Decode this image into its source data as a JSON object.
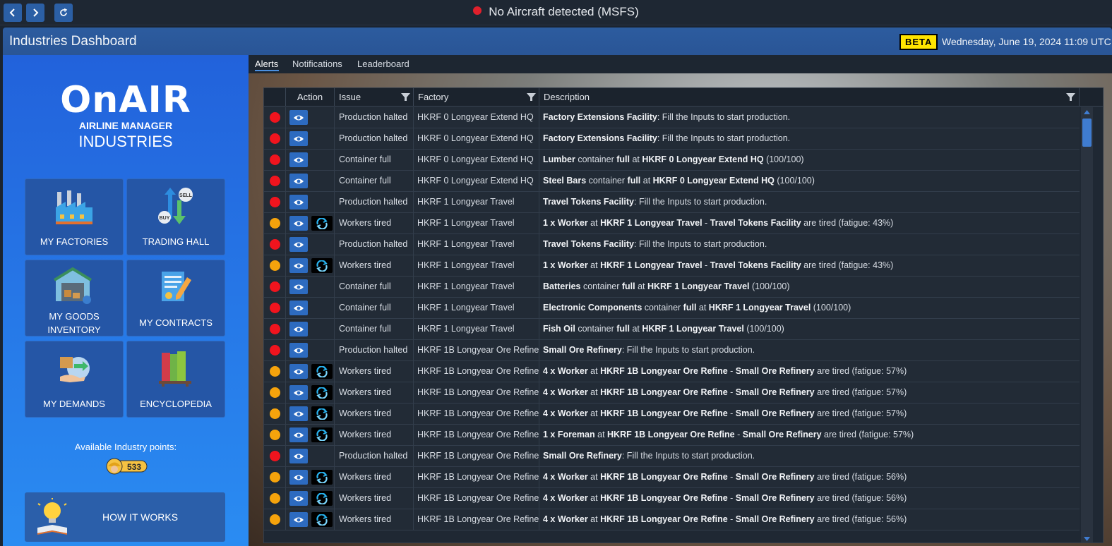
{
  "topbar": {
    "status_text": "No Aircraft detected (MSFS)",
    "status_color": "#e0202c"
  },
  "header": {
    "title": "Industries Dashboard",
    "beta_label": "BETA",
    "datetime": "Wednesday, June 19, 2024 11:09 UTC"
  },
  "logo": {
    "word": "OnAIR",
    "line1": "AIRLINE MANAGER",
    "line2": "INDUSTRIES"
  },
  "tiles": [
    {
      "label": "MY FACTORIES",
      "icon": "factory-icon"
    },
    {
      "label": "TRADING HALL",
      "icon": "buy-sell-icon"
    },
    {
      "label": "MY GOODS INVENTORY",
      "icon": "warehouse-icon"
    },
    {
      "label": "MY CONTRACTS",
      "icon": "contract-icon"
    },
    {
      "label": "MY DEMANDS",
      "icon": "demand-icon"
    },
    {
      "label": "ENCYCLOPEDIA",
      "icon": "books-icon"
    }
  ],
  "points": {
    "label": "Available Industry points:",
    "value": "533"
  },
  "howto": {
    "label": "HOW IT WORKS"
  },
  "tabs": [
    {
      "label": "Alerts",
      "active": true
    },
    {
      "label": "Notifications",
      "active": false
    },
    {
      "label": "Leaderboard",
      "active": false
    }
  ],
  "columns": {
    "action": "Action",
    "issue": "Issue",
    "factory": "Factory",
    "description": "Description"
  },
  "colors": {
    "red": "#f0141e",
    "orange": "#f5a30c"
  },
  "rows": [
    {
      "sev": "red",
      "refresh": false,
      "issue": "Production halted",
      "factory": "HKRF 0 Longyear Extend HQ",
      "desc": [
        [
          "b",
          "Factory Extensions Facility"
        ],
        [
          "t",
          ": Fill the Inputs to start production."
        ]
      ]
    },
    {
      "sev": "red",
      "refresh": false,
      "issue": "Production halted",
      "factory": "HKRF 0 Longyear Extend HQ",
      "desc": [
        [
          "b",
          "Factory Extensions Facility"
        ],
        [
          "t",
          ": Fill the Inputs to start production."
        ]
      ]
    },
    {
      "sev": "red",
      "refresh": false,
      "issue": "Container full",
      "factory": "HKRF 0 Longyear Extend HQ",
      "desc": [
        [
          "b",
          "Lumber"
        ],
        [
          "t",
          " container "
        ],
        [
          "b",
          "full"
        ],
        [
          "t",
          " at "
        ],
        [
          "b",
          "HKRF 0 Longyear Extend HQ"
        ],
        [
          "t",
          " (100/100)"
        ]
      ]
    },
    {
      "sev": "red",
      "refresh": false,
      "issue": "Container full",
      "factory": "HKRF 0 Longyear Extend HQ",
      "desc": [
        [
          "b",
          "Steel Bars"
        ],
        [
          "t",
          " container "
        ],
        [
          "b",
          "full"
        ],
        [
          "t",
          " at "
        ],
        [
          "b",
          "HKRF 0 Longyear Extend HQ"
        ],
        [
          "t",
          " (100/100)"
        ]
      ]
    },
    {
      "sev": "red",
      "refresh": false,
      "issue": "Production halted",
      "factory": "HKRF 1 Longyear Travel",
      "desc": [
        [
          "b",
          "Travel Tokens Facility"
        ],
        [
          "t",
          ": Fill the Inputs to start production."
        ]
      ]
    },
    {
      "sev": "orange",
      "refresh": true,
      "issue": "Workers tired",
      "factory": "HKRF 1 Longyear Travel",
      "desc": [
        [
          "b",
          "1 x Worker"
        ],
        [
          "t",
          " at "
        ],
        [
          "b",
          "HKRF 1 Longyear Travel"
        ],
        [
          "t",
          " - "
        ],
        [
          "b",
          "Travel Tokens Facility"
        ],
        [
          "t",
          " are tired (fatigue: 43%)"
        ]
      ]
    },
    {
      "sev": "red",
      "refresh": false,
      "issue": "Production halted",
      "factory": "HKRF 1 Longyear Travel",
      "desc": [
        [
          "b",
          "Travel Tokens Facility"
        ],
        [
          "t",
          ": Fill the Inputs to start production."
        ]
      ]
    },
    {
      "sev": "orange",
      "refresh": true,
      "issue": "Workers tired",
      "factory": "HKRF 1 Longyear Travel",
      "desc": [
        [
          "b",
          "1 x Worker"
        ],
        [
          "t",
          " at "
        ],
        [
          "b",
          "HKRF 1 Longyear Travel"
        ],
        [
          "t",
          " - "
        ],
        [
          "b",
          "Travel Tokens Facility"
        ],
        [
          "t",
          " are tired (fatigue: 43%)"
        ]
      ]
    },
    {
      "sev": "red",
      "refresh": false,
      "issue": "Container full",
      "factory": "HKRF 1 Longyear Travel",
      "desc": [
        [
          "b",
          "Batteries"
        ],
        [
          "t",
          " container "
        ],
        [
          "b",
          "full"
        ],
        [
          "t",
          " at "
        ],
        [
          "b",
          "HKRF 1 Longyear Travel"
        ],
        [
          "t",
          " (100/100)"
        ]
      ]
    },
    {
      "sev": "red",
      "refresh": false,
      "issue": "Container full",
      "factory": "HKRF 1 Longyear Travel",
      "desc": [
        [
          "b",
          "Electronic Components"
        ],
        [
          "t",
          " container "
        ],
        [
          "b",
          "full"
        ],
        [
          "t",
          " at "
        ],
        [
          "b",
          "HKRF 1 Longyear Travel"
        ],
        [
          "t",
          " (100/100)"
        ]
      ]
    },
    {
      "sev": "red",
      "refresh": false,
      "issue": "Container full",
      "factory": "HKRF 1 Longyear Travel",
      "desc": [
        [
          "b",
          "Fish Oil"
        ],
        [
          "t",
          " container "
        ],
        [
          "b",
          "full"
        ],
        [
          "t",
          " at "
        ],
        [
          "b",
          "HKRF 1 Longyear Travel"
        ],
        [
          "t",
          " (100/100)"
        ]
      ]
    },
    {
      "sev": "red",
      "refresh": false,
      "issue": "Production halted",
      "factory": "HKRF 1B Longyear Ore Refine",
      "desc": [
        [
          "b",
          "Small Ore Refinery"
        ],
        [
          "t",
          ": Fill the Inputs to start production."
        ]
      ]
    },
    {
      "sev": "orange",
      "refresh": true,
      "issue": "Workers tired",
      "factory": "HKRF 1B Longyear Ore Refine",
      "desc": [
        [
          "b",
          "4 x Worker"
        ],
        [
          "t",
          " at "
        ],
        [
          "b",
          "HKRF 1B Longyear Ore Refine"
        ],
        [
          "t",
          " - "
        ],
        [
          "b",
          "Small Ore Refinery"
        ],
        [
          "t",
          " are tired (fatigue: 57%)"
        ]
      ]
    },
    {
      "sev": "orange",
      "refresh": true,
      "issue": "Workers tired",
      "factory": "HKRF 1B Longyear Ore Refine",
      "desc": [
        [
          "b",
          "4 x Worker"
        ],
        [
          "t",
          " at "
        ],
        [
          "b",
          "HKRF 1B Longyear Ore Refine"
        ],
        [
          "t",
          " - "
        ],
        [
          "b",
          "Small Ore Refinery"
        ],
        [
          "t",
          " are tired (fatigue: 57%)"
        ]
      ]
    },
    {
      "sev": "orange",
      "refresh": true,
      "issue": "Workers tired",
      "factory": "HKRF 1B Longyear Ore Refine",
      "desc": [
        [
          "b",
          "4 x Worker"
        ],
        [
          "t",
          " at "
        ],
        [
          "b",
          "HKRF 1B Longyear Ore Refine"
        ],
        [
          "t",
          " - "
        ],
        [
          "b",
          "Small Ore Refinery"
        ],
        [
          "t",
          " are tired (fatigue: 57%)"
        ]
      ]
    },
    {
      "sev": "orange",
      "refresh": true,
      "issue": "Workers tired",
      "factory": "HKRF 1B Longyear Ore Refine",
      "desc": [
        [
          "b",
          "1 x Foreman"
        ],
        [
          "t",
          " at "
        ],
        [
          "b",
          "HKRF 1B Longyear Ore Refine"
        ],
        [
          "t",
          " - "
        ],
        [
          "b",
          "Small Ore Refinery"
        ],
        [
          "t",
          " are tired (fatigue: 57%)"
        ]
      ]
    },
    {
      "sev": "red",
      "refresh": false,
      "issue": "Production halted",
      "factory": "HKRF 1B Longyear Ore Refine",
      "desc": [
        [
          "b",
          "Small Ore Refinery"
        ],
        [
          "t",
          ": Fill the Inputs to start production."
        ]
      ]
    },
    {
      "sev": "orange",
      "refresh": true,
      "issue": "Workers tired",
      "factory": "HKRF 1B Longyear Ore Refine",
      "desc": [
        [
          "b",
          "4 x Worker"
        ],
        [
          "t",
          " at "
        ],
        [
          "b",
          "HKRF 1B Longyear Ore Refine"
        ],
        [
          "t",
          " - "
        ],
        [
          "b",
          "Small Ore Refinery"
        ],
        [
          "t",
          " are tired (fatigue: 56%)"
        ]
      ]
    },
    {
      "sev": "orange",
      "refresh": true,
      "issue": "Workers tired",
      "factory": "HKRF 1B Longyear Ore Refine",
      "desc": [
        [
          "b",
          "4 x Worker"
        ],
        [
          "t",
          " at "
        ],
        [
          "b",
          "HKRF 1B Longyear Ore Refine"
        ],
        [
          "t",
          " - "
        ],
        [
          "b",
          "Small Ore Refinery"
        ],
        [
          "t",
          " are tired (fatigue: 56%)"
        ]
      ]
    },
    {
      "sev": "orange",
      "refresh": true,
      "issue": "Workers tired",
      "factory": "HKRF 1B Longyear Ore Refine",
      "desc": [
        [
          "b",
          "4 x Worker"
        ],
        [
          "t",
          " at "
        ],
        [
          "b",
          "HKRF 1B Longyear Ore Refine"
        ],
        [
          "t",
          " - "
        ],
        [
          "b",
          "Small Ore Refinery"
        ],
        [
          "t",
          " are tired (fatigue: 56%)"
        ]
      ]
    }
  ]
}
